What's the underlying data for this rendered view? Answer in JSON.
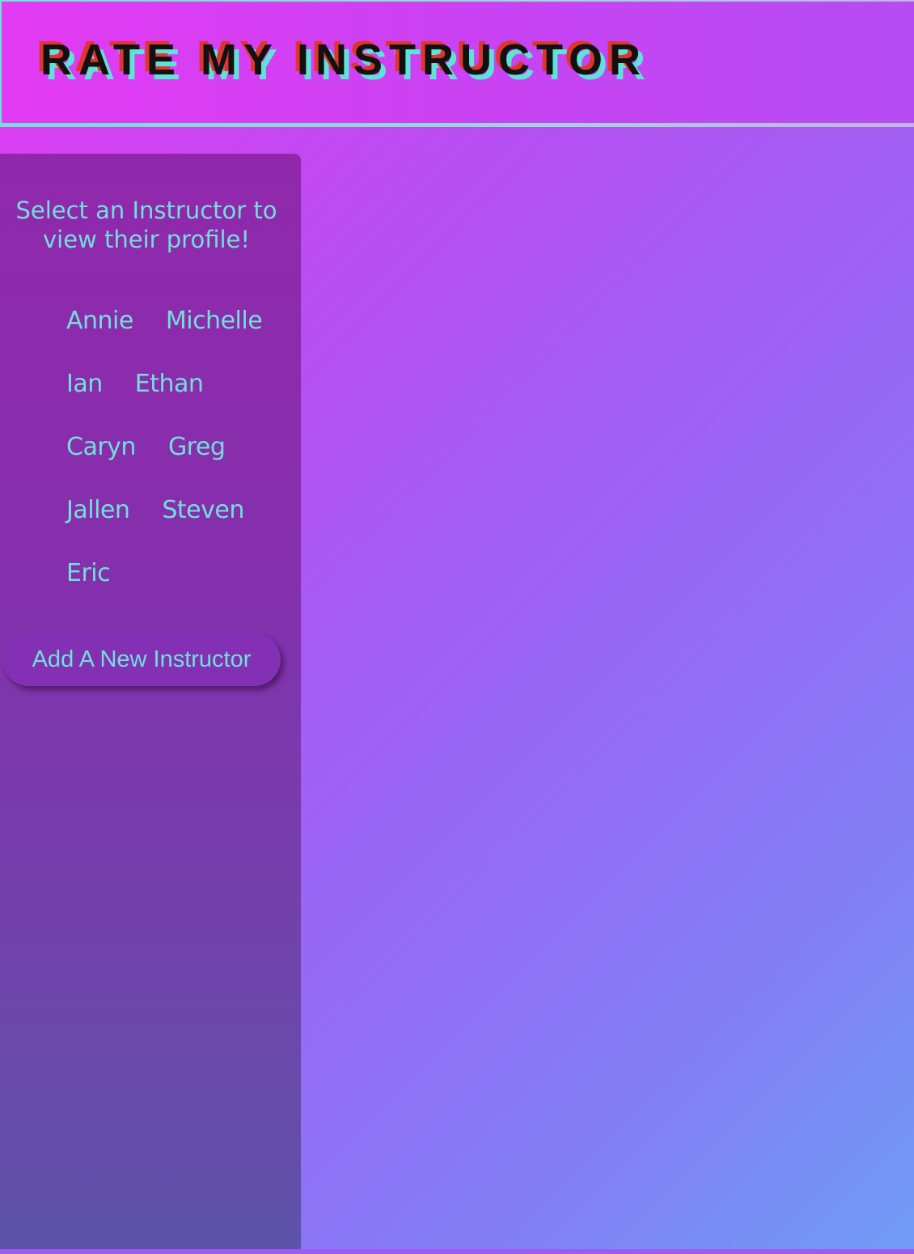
{
  "header": {
    "title": "RATE MY INSTRUCTOR"
  },
  "sidebar": {
    "heading_line1": "Select an Instructor to",
    "heading_line2": "view their profile!",
    "instructors": [
      "Annie",
      "Michelle",
      "Ian",
      "Ethan",
      "Caryn",
      "Greg",
      "Jallen",
      "Steven",
      "Eric"
    ],
    "add_button_label": "Add A New Instructor"
  },
  "colors": {
    "accent_text": "#72dfda",
    "title_shadow_red": "#e0352a",
    "title_shadow_cyan": "#5fe3d8",
    "sidebar_top": "#9128ac",
    "sidebar_bottom": "#5c53aa",
    "background_start": "#e33af3",
    "background_end": "#6f9cf6"
  }
}
